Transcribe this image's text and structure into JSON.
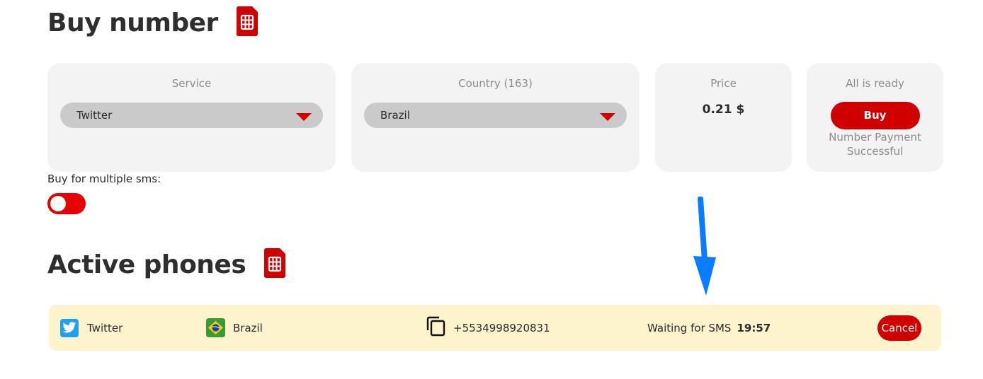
{
  "buy_section": {
    "title": "Buy number"
  },
  "service": {
    "label": "Service",
    "selected": "Twitter"
  },
  "country": {
    "label": "Country (163)",
    "selected": "Brazil"
  },
  "price": {
    "label": "Price",
    "value": "0.21 $"
  },
  "ready": {
    "label": "All is ready",
    "buy_button": "Buy",
    "status": "Number Payment Successful"
  },
  "multiple_sms": {
    "label": "Buy for multiple sms:",
    "enabled": false
  },
  "active_section": {
    "title": "Active phones"
  },
  "active_phones": [
    {
      "service": "Twitter",
      "country": "Brazil",
      "number": "+5534998920831",
      "status": "Waiting for SMS",
      "timer": "19:57",
      "cancel_label": "Cancel"
    }
  ],
  "colors": {
    "accent": "#d00000",
    "card_bg": "#f3f3f3",
    "row_bg": "#fdf3cd",
    "annotation_arrow": "#0a7cff"
  },
  "icons": {
    "sim": "sim-card-icon",
    "caret": "caret-down-icon",
    "twitter": "twitter-icon",
    "flag": "brazil-flag-icon",
    "copy": "copy-icon",
    "arrow": "arrow-down-icon"
  }
}
